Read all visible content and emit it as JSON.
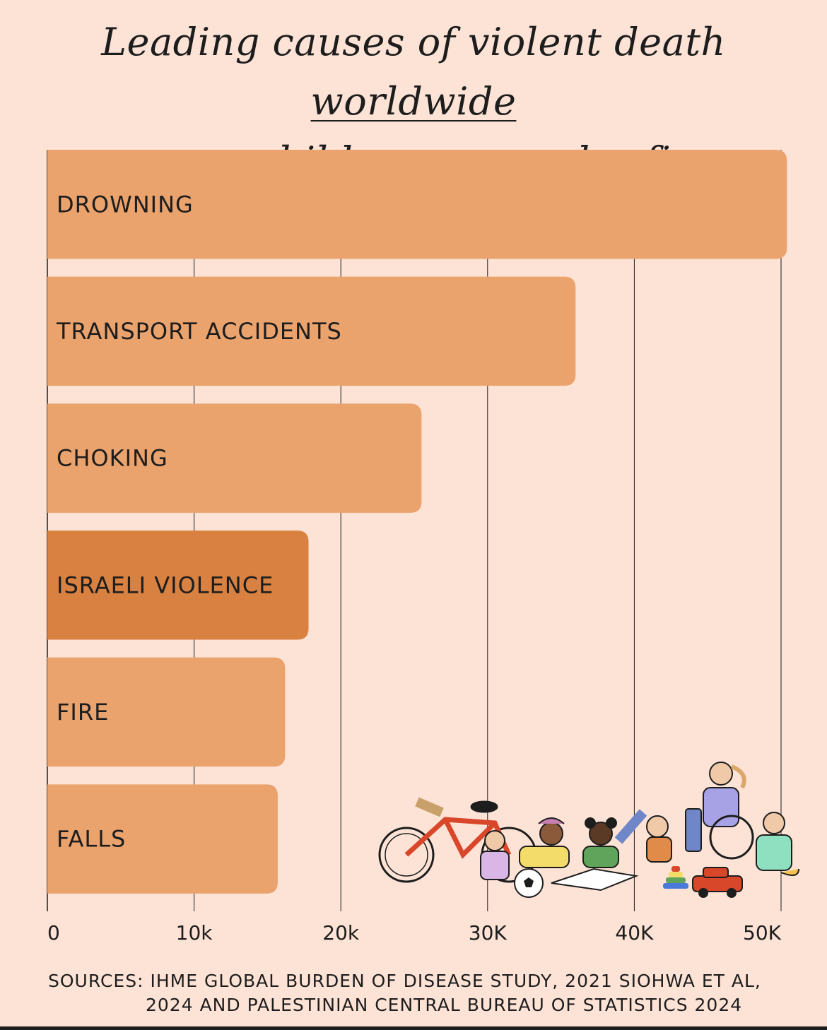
{
  "title": {
    "line1_main": "Leading causes of violent death",
    "line1_underlined": "worldwide",
    "line2": "among children age under five"
  },
  "chart_data": {
    "type": "bar",
    "orientation": "horizontal",
    "categories": [
      "DROWNING",
      "TRANSPORT ACCIDENTS",
      "CHOKING",
      "ISRAELI VIOLENCE",
      "FIRE",
      "FALLS"
    ],
    "values": [
      50400,
      36000,
      25500,
      17800,
      16200,
      15700
    ],
    "highlight": "ISRAELI VIOLENCE",
    "xlim": [
      0,
      50000
    ],
    "xticks": [
      0,
      10000,
      20000,
      30000,
      40000,
      50000
    ],
    "xtick_labels": [
      "0",
      "10k",
      "20k",
      "30K",
      "40K",
      "50K"
    ],
    "grid": "vertical",
    "colors": {
      "bar": "#eba36e",
      "highlight": "#d98141",
      "background": "#fde3d6",
      "grid": "#1d1d1d"
    }
  },
  "sources": {
    "line1": "SOURCES: IHME GLOBAL BURDEN OF DISEASE STUDY, 2021 SIOHWA ET AL,",
    "line2": "2024 AND PALESTINIAN CENTRAL BUREAU OF STATISTICS 2024"
  },
  "illustration": {
    "icons": [
      "bicycle-icon",
      "soccer-ball-icon",
      "book-icon",
      "stacking-rings-icon",
      "wheelchair-icon",
      "toy-car-icon",
      "children-icon"
    ]
  }
}
